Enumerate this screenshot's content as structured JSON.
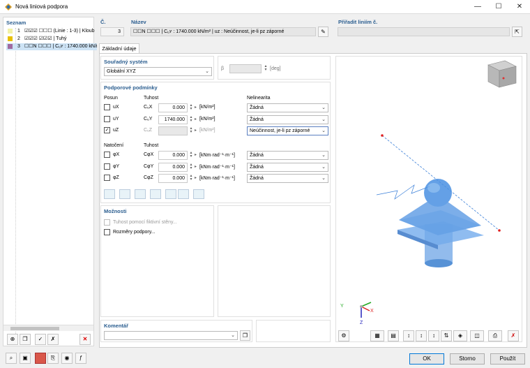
{
  "window": {
    "title": "Nová liniová podpora",
    "minimize": "—",
    "maximize": "☐",
    "close": "✕"
  },
  "list": {
    "header": "Seznam",
    "items": [
      {
        "num": "1",
        "text": "☑☑☑ ☐☐☐ (Linie : 1-3) | Kloub",
        "color": "#f2f2a6"
      },
      {
        "num": "2",
        "text": "☑☑☑ ☑☑☑ | Tuhý",
        "color": "#e8c000"
      },
      {
        "num": "3",
        "text": "☐☐N ☐☐☐ | Cᵤʏ : 1740.000 kN/m²",
        "color": "#a06aa0"
      }
    ]
  },
  "number": {
    "label": "Č.",
    "value": "3"
  },
  "name": {
    "label": "Název",
    "value": "☐☐N ☐☐☐ | Cᵤʏ : 1740.000 kN/m² | uᴢ : Neúčinnost, je-li pz záporné"
  },
  "assign": {
    "label": "Přiřadit liniím č.",
    "value": ""
  },
  "tab": "Základní údaje",
  "coord": {
    "header": "Souřadný systém",
    "value": "Globální XYZ",
    "beta_label": "β",
    "beta_unit": "[deg]"
  },
  "supports": {
    "header": "Podporové podmínky",
    "posun": "Posun",
    "tuhost": "Tuhost",
    "nelinearita": "Nelinearita",
    "natoceni": "Natočení",
    "tuhost2": "Tuhost",
    "rows": [
      {
        "dof": "uX",
        "checked": false,
        "c": "CᵤX",
        "val": "0.000",
        "unit": "[kN/m²]",
        "nl": "Žádná",
        "dis": false
      },
      {
        "dof": "uY",
        "checked": false,
        "c": "CᵤY",
        "val": "1740.000",
        "unit": "[kN/m²]",
        "nl": "Žádná",
        "dis": false
      },
      {
        "dof": "uZ",
        "checked": true,
        "c": "CᵤZ",
        "val": "",
        "unit": "[kN/m²]",
        "nl": "Neúčinnost, je-li pz záporné",
        "dis": true
      },
      {
        "dof": "φX",
        "checked": false,
        "c": "CφX",
        "val": "0.000",
        "unit": "[kNm·rad⁻¹·m⁻¹]",
        "nl": "Žádná",
        "dis": false
      },
      {
        "dof": "φY",
        "checked": false,
        "c": "CφY",
        "val": "0.000",
        "unit": "[kNm·rad⁻¹·m⁻¹]",
        "nl": "Žádná",
        "dis": false
      },
      {
        "dof": "φZ",
        "checked": false,
        "c": "CφZ",
        "val": "0.000",
        "unit": "[kNm·rad⁻¹·m⁻¹]",
        "nl": "Žádná",
        "dis": false
      }
    ]
  },
  "options": {
    "header": "Možnosti",
    "opt1": "Tuhost pomocí fiktivní stěny...",
    "opt2": "Rozměry podpory..."
  },
  "comment": {
    "header": "Komentář"
  },
  "buttons": {
    "ok": "OK",
    "cancel": "Storno",
    "apply": "Použít"
  },
  "axes": {
    "y": "Y",
    "x": "X",
    "z": "Z"
  }
}
